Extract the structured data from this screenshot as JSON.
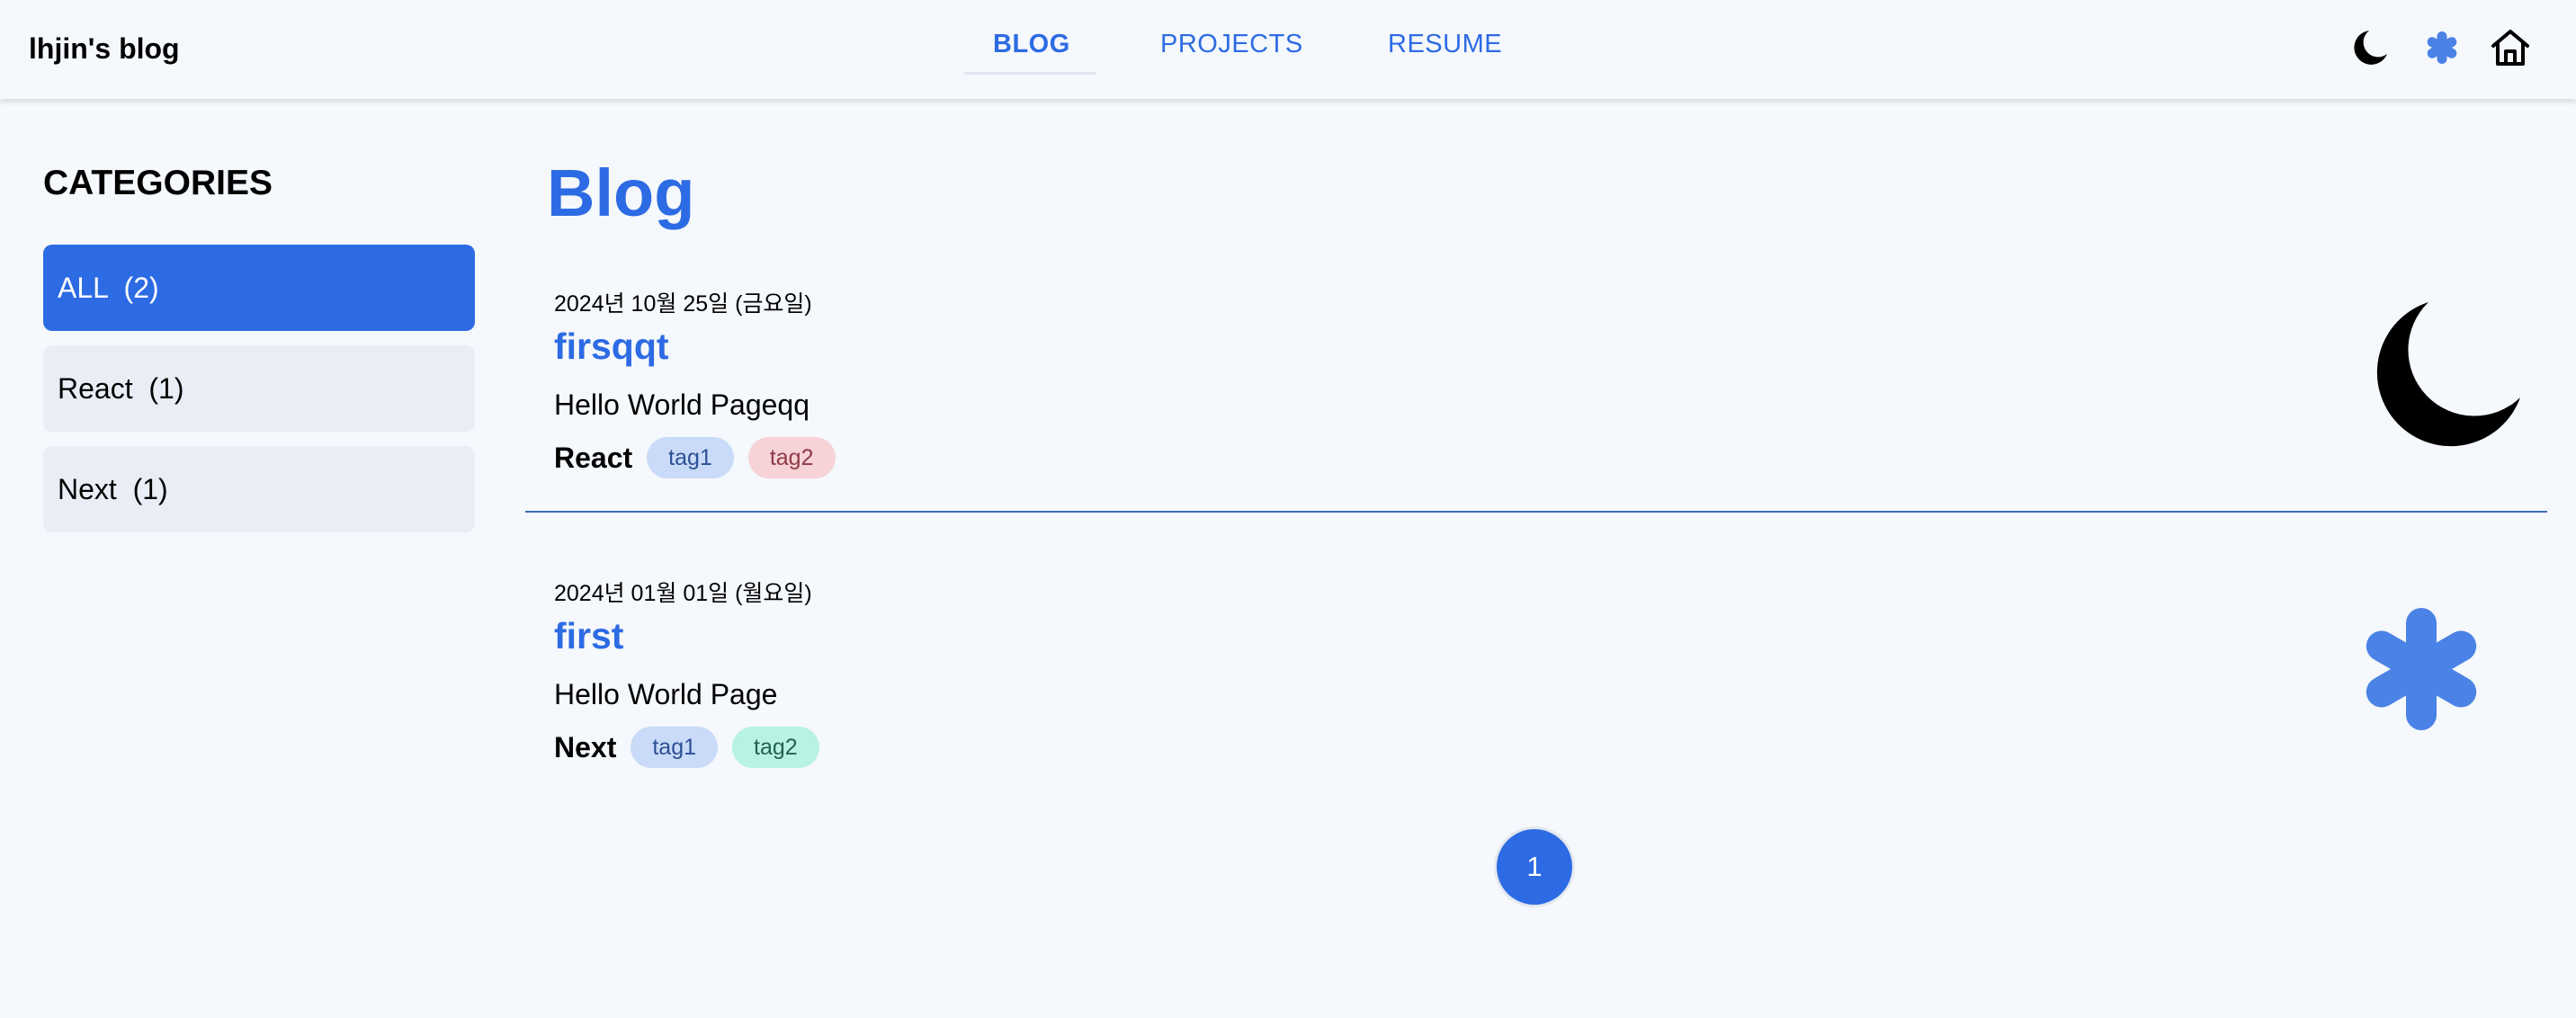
{
  "header": {
    "site_title": "lhjin's blog",
    "nav": [
      {
        "label": "BLOG",
        "active": true
      },
      {
        "label": "PROJECTS",
        "active": false
      },
      {
        "label": "RESUME",
        "active": false
      }
    ],
    "icons": [
      "moon-icon",
      "asterisk-icon",
      "home-icon"
    ]
  },
  "sidebar": {
    "title": "CATEGORIES",
    "items": [
      {
        "label": "ALL  (2)",
        "active": true
      },
      {
        "label": "React  (1)",
        "active": false
      },
      {
        "label": "Next  (1)",
        "active": false
      }
    ]
  },
  "main": {
    "title": "Blog",
    "posts": [
      {
        "date": "2024년 10월 25일 (금요일)",
        "title": "firsqqt",
        "description": "Hello World Pageqq",
        "category": "React",
        "tags": [
          "tag1",
          "tag2"
        ],
        "thumbnail": "moon-icon"
      },
      {
        "date": "2024년 01월 01일 (월요일)",
        "title": "first",
        "description": "Hello World Page",
        "category": "Next",
        "tags": [
          "tag1",
          "tag2"
        ],
        "thumbnail": "asterisk-icon"
      }
    ]
  },
  "pagination": {
    "current": "1"
  },
  "colors": {
    "accent": "#2d6be4",
    "background": "#f5f8fc",
    "category_bg": "#e9edf5",
    "divider": "#3b6cb6"
  }
}
